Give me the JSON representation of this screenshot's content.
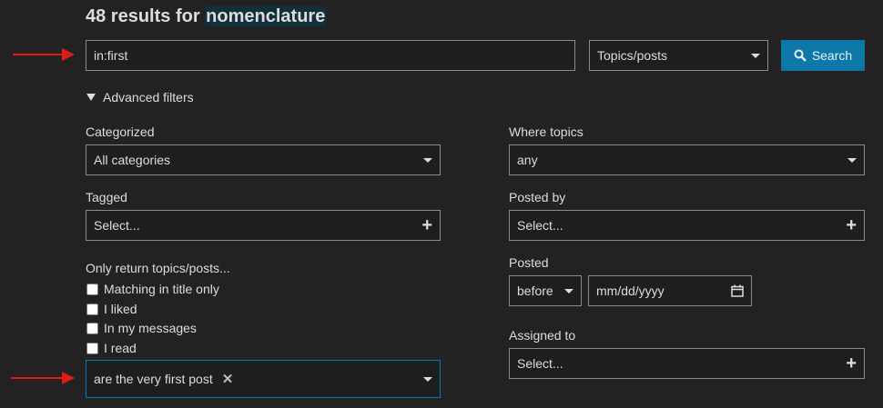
{
  "header": {
    "results_prefix": "48 results for",
    "query_term": "nomenclature"
  },
  "search": {
    "input_value": "in:first",
    "type_selected": "Topics/posts",
    "search_label": "Search"
  },
  "advanced": {
    "toggle_label": "Advanced filters",
    "categorized_label": "Categorized",
    "categorized_value": "All categories",
    "tagged_label": "Tagged",
    "tagged_value": "Select...",
    "only_return_label": "Only return topics/posts...",
    "checkboxes": [
      {
        "label": "Matching in title only",
        "checked": false
      },
      {
        "label": "I liked",
        "checked": false
      },
      {
        "label": "In my messages",
        "checked": false
      },
      {
        "label": "I read",
        "checked": false
      }
    ],
    "post_filter_value": "are the very first post",
    "where_topics_label": "Where topics",
    "where_topics_value": "any",
    "posted_by_label": "Posted by",
    "posted_by_value": "Select...",
    "posted_label": "Posted",
    "posted_relation": "before",
    "posted_date_placeholder": "mm/dd/yyyy",
    "assigned_to_label": "Assigned to",
    "assigned_to_value": "Select..."
  },
  "colors": {
    "background": "#222222",
    "accent": "#0d77a8",
    "annotation_arrow": "#e01919",
    "focus_border": "#0d77a8"
  }
}
